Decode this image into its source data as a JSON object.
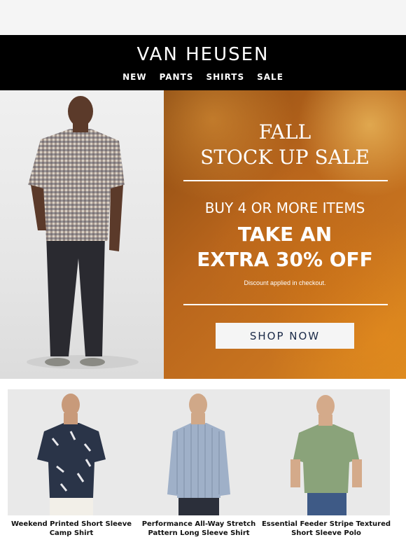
{
  "brand": {
    "logo": "VAN HEUSEN"
  },
  "nav": [
    {
      "label": "NEW"
    },
    {
      "label": "PANTS"
    },
    {
      "label": "SHIRTS"
    },
    {
      "label": "SALE"
    }
  ],
  "hero": {
    "headline_line1": "FALL",
    "headline_line2": "STOCK UP SALE",
    "offer_line1": "BUY 4 OR MORE ITEMS",
    "offer_line2": "TAKE AN",
    "offer_line3": "EXTRA 30% OFF",
    "disclaimer": "Discount applied in checkout.",
    "cta_label": "SHOP NOW"
  },
  "products": [
    {
      "name_line1": "Weekend Printed Short Sleeve",
      "name_line2": "Camp Shirt"
    },
    {
      "name_line1": "Performance All-Way Stretch",
      "name_line2": "Pattern Long Sleeve Shirt"
    },
    {
      "name_line1": "Essential Feeder Stripe Textured",
      "name_line2": "Short Sleeve Polo"
    }
  ],
  "colors": {
    "header_bg": "#000000",
    "accent_orange": "#c7731f",
    "cta_text": "#1b2a48"
  }
}
